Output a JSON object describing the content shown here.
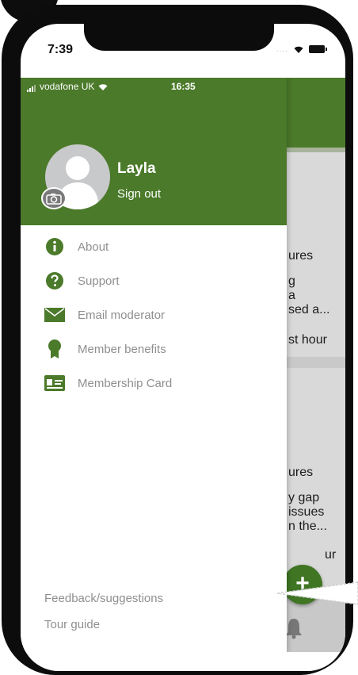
{
  "outer_status": {
    "time": "7:39",
    "signal_dots": "...."
  },
  "inner_status": {
    "carrier": "vodafone UK",
    "time": "16:35"
  },
  "drawer": {
    "user": {
      "name": "Layla",
      "sign_out": "Sign out"
    },
    "menu": [
      {
        "label": "About",
        "icon": "info-icon"
      },
      {
        "label": "Support",
        "icon": "question-icon"
      },
      {
        "label": "Email moderator",
        "icon": "envelope-icon"
      },
      {
        "label": "Member benefits",
        "icon": "award-ribbon-icon"
      },
      {
        "label": "Membership Card",
        "icon": "id-card-icon"
      }
    ],
    "footer": {
      "feedback": "Feedback/suggestions",
      "tour": "Tour guide"
    }
  },
  "background_feed": {
    "item1": {
      "line1": "ures",
      "line2": "g",
      "line3": "a",
      "line4": "sed a...",
      "line5": "st hour"
    },
    "item2": {
      "line1": "ures",
      "line2": "y gap",
      "line3": "issues",
      "line4": "n the...",
      "line5": "ur"
    }
  },
  "fab_label": "+",
  "colors": {
    "brand_green": "#4b7a2a",
    "fab_green": "#3f7523",
    "menu_text": "#8f8f8f"
  }
}
